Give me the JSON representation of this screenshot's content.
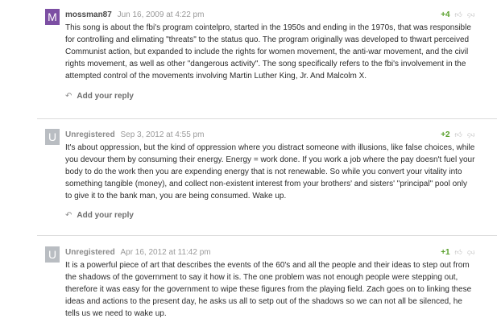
{
  "comments": [
    {
      "avatar_letter": "M",
      "author": "mossman87",
      "date": "Jun 16, 2009 at 4:22 pm",
      "score": "+4",
      "lines": [
        "This song is about the fbi's program cointelpro, started in the 1950s and ending in the 1970s, that was responsible",
        "for controlling and elimating \"threats\" to the status quo. The program originally was developed to thwart perceived",
        "Communist action, but expanded to include the rights for women movement, the anti-war movement, and the civil",
        "rights movement, as well as other \"dangerous activity\". The song specifically refers to the fbi's involvement in the",
        "attempted control of the movements involving Martin Luther King, Jr. And Malcolm X."
      ],
      "reply_label": "Add your reply"
    },
    {
      "avatar_letter": "U",
      "author": "Unregistered",
      "date": "Sep 3, 2012 at 4:55 pm",
      "score": "+2",
      "lines": [
        "It's about oppression, but the kind of oppression where you distract someone with illusions, like false choices, while",
        "you devour them by consuming their energy. Energy = work done. If you work a job where the pay doesn't fuel your",
        "body to do the work then you are expending energy that is not renewable. So while you convert your vitality into",
        "something tangible (money), and collect non-existent interest from your brothers' and sisters' \"principal\" pool only",
        "to give it to the bank man, you are being consumed. Wake up."
      ],
      "reply_label": "Add your reply"
    },
    {
      "avatar_letter": "U",
      "author": "Unregistered",
      "date": "Apr 16, 2012 at 11:42 pm",
      "score": "+1",
      "lines": [
        "It is a powerful piece of art that describes the events of the 60's and all the people and their ideas to step out from",
        "the shadows of the government to say it how it is. The one problem was not enough people were stepping out,",
        "therefore it was easy for the government to wipe these figures from the playing field. Zach goes on to linking these",
        "ideas and actions to the present day, he asks us all to setp out of the shadows so we can not all be silenced, he",
        "tells us we need to wake up."
      ]
    }
  ],
  "icons": {
    "thumb_up": "thumbs-up-icon",
    "thumb_down": "thumbs-down-icon",
    "reply": "reply-arrow-icon"
  },
  "colors": {
    "avatar_registered": "#7c4fa3",
    "avatar_unregistered": "#b9bdc2",
    "score_positive": "#5aa02c"
  }
}
